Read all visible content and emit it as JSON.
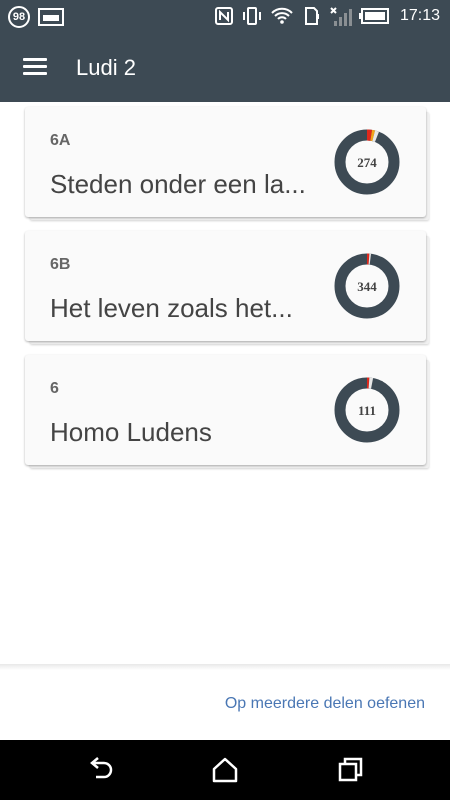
{
  "status_bar": {
    "notification_count": "98",
    "time": "17:13",
    "icons": [
      "notification-badge-icon",
      "image-icon",
      "nfc-icon",
      "vibrate-icon",
      "wifi-icon",
      "sd-card-icon",
      "signal-icon",
      "battery-icon"
    ]
  },
  "app_bar": {
    "title": "Ludi 2",
    "menu_icon": "hamburger-menu-icon"
  },
  "colors": {
    "app_bar": "#3d4a54",
    "donut_ring": "#3d4a54",
    "donut_red": "#e0281c",
    "donut_orange": "#f2a51a",
    "donut_light": "#e7e7e7",
    "link": "#4a77b4"
  },
  "cards": [
    {
      "code": "6A",
      "title": "Steden onder een la...",
      "count": "274",
      "segments": [
        {
          "color": "#e0281c",
          "fraction": 0.025
        },
        {
          "color": "#f2a51a",
          "fraction": 0.015
        },
        {
          "color": "#e7e7e7",
          "fraction": 0.02
        }
      ]
    },
    {
      "code": "6B",
      "title": "Het leven zoals het...",
      "count": "344",
      "segments": [
        {
          "color": "#e0281c",
          "fraction": 0.012
        },
        {
          "color": "#e7e7e7",
          "fraction": 0.008
        }
      ]
    },
    {
      "code": "6",
      "title": "Homo Ludens",
      "count": "111",
      "segments": [
        {
          "color": "#e0281c",
          "fraction": 0.012
        },
        {
          "color": "#e7e7e7",
          "fraction": 0.018
        }
      ]
    }
  ],
  "footer": {
    "practice_label": "Op meerdere delen oefenen"
  },
  "nav_bar": {
    "icons": [
      "back-icon",
      "home-icon",
      "recent-apps-icon"
    ]
  }
}
